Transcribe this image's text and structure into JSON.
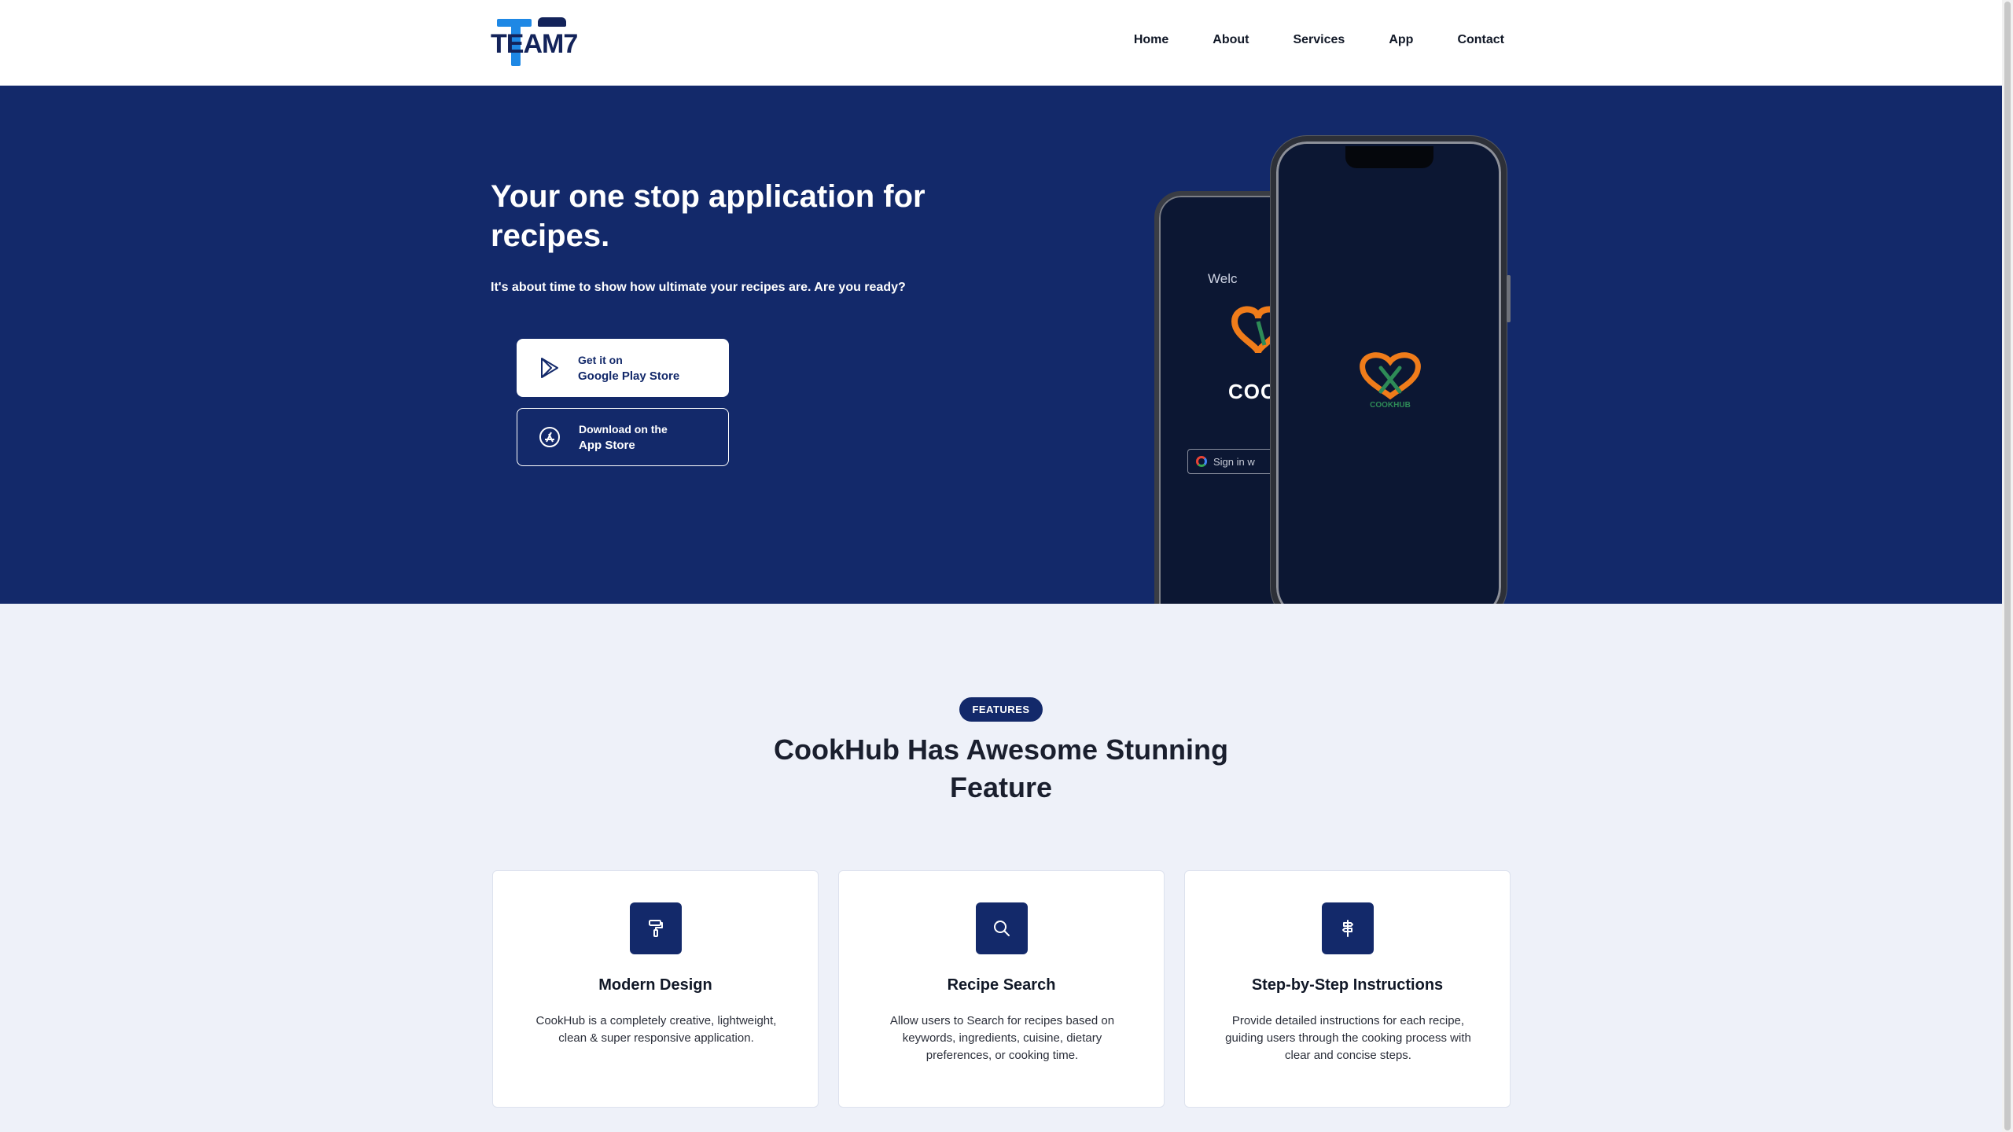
{
  "header": {
    "logo_text": "TEAM7",
    "nav": [
      "Home",
      "About",
      "Services",
      "App",
      "Contact"
    ]
  },
  "hero": {
    "title": "Your one stop application for recipes.",
    "subtitle": "It's about time to show how ultimate your recipes are. Are you ready?",
    "play_store": {
      "small": "Get it on",
      "big": "Google Play Store"
    },
    "app_store": {
      "small": "Download on the",
      "big": "App Store"
    },
    "phone_back": {
      "welcome": "Welc",
      "cook": "COO",
      "signin": "Sign in w"
    },
    "phone_front": {
      "app_name": "COOKHUB"
    }
  },
  "features": {
    "badge": "FEATURES",
    "title": "CookHub Has Awesome Stunning Feature",
    "cards": [
      {
        "icon": "paint-roller-icon",
        "title": "Modern Design",
        "desc": "CookHub is a completely creative, lightweight, clean & super responsive application."
      },
      {
        "icon": "search-icon",
        "title": "Recipe Search",
        "desc": "Allow users to Search for recipes based on keywords, ingredients, cuisine, dietary preferences, or cooking time."
      },
      {
        "icon": "signpost-icon",
        "title": "Step-by-Step Instructions",
        "desc": "Provide detailed instructions for each recipe, guiding users through the cooking process with clear and concise steps."
      }
    ]
  },
  "colors": {
    "navy": "#13296a",
    "accent_blue": "#1e88e5",
    "background": "#eef1f9"
  }
}
